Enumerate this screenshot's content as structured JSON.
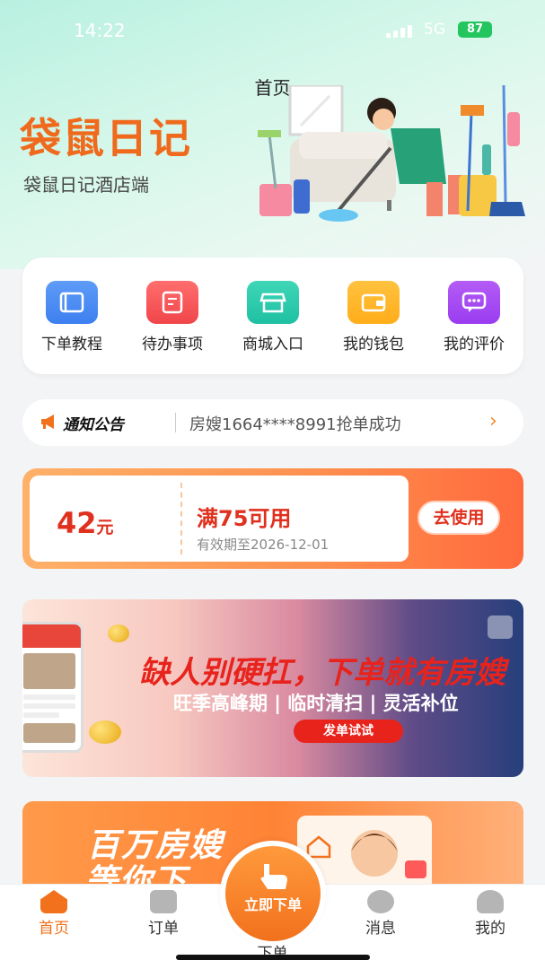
{
  "status": {
    "time": "14:22",
    "network": "5G",
    "battery": "87"
  },
  "header": {
    "title": "首页",
    "brand": "袋鼠日记",
    "subtitle": "袋鼠日记酒店端"
  },
  "quick_actions": [
    {
      "label": "下单教程",
      "icon": "book-icon",
      "color": "#3d7ff0"
    },
    {
      "label": "待办事项",
      "icon": "checklist-icon",
      "color": "#f0454a"
    },
    {
      "label": "商城入口",
      "icon": "store-icon",
      "color": "#1fc0a3"
    },
    {
      "label": "我的钱包",
      "icon": "wallet-icon",
      "color": "#ffad1a"
    },
    {
      "label": "我的评价",
      "icon": "chat-icon",
      "color": "#9a3cf0"
    }
  ],
  "notice": {
    "title": "通知公告",
    "text": "房嫂1664****8991抢单成功",
    "icon": "megaphone-icon"
  },
  "coupon": {
    "amount": "42",
    "unit": "元",
    "condition": "满75可用",
    "validity": "有效期至2026-12-01",
    "action": "去使用"
  },
  "banner1": {
    "title": "缺人别硬扛，下单就有房嫂",
    "subtitle": "旺季高峰期 | 临时清扫 | 灵活补位",
    "button": "发单试试"
  },
  "banner2": {
    "line1": "百万房嫂",
    "line2": "等你下"
  },
  "tabbar": {
    "home": "首页",
    "orders": "订单",
    "messages": "消息",
    "mine": "我的",
    "fab": "立即下单",
    "fab_under": "下单"
  },
  "colors": {
    "accent": "#f2711c",
    "brand": "#ef6a1c",
    "danger": "#e0301e"
  }
}
